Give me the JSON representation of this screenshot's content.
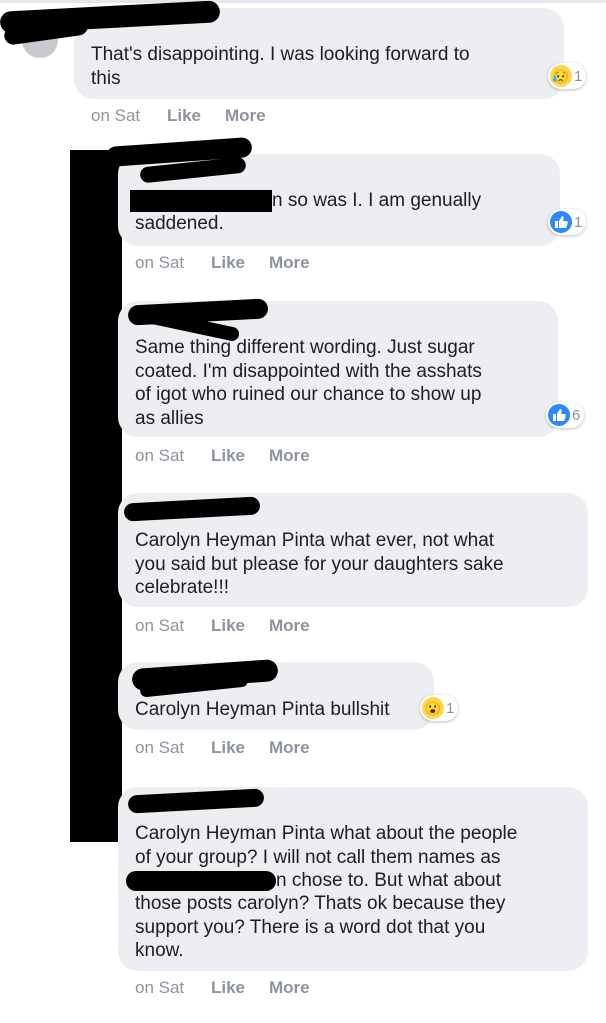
{
  "comments": [
    {
      "text": "That's disappointing. I was looking forward to\nthis",
      "timestamp": "on Sat",
      "like_label": "Like",
      "more_label": "More",
      "reaction": {
        "icon": "sad-emoji-icon",
        "glyph": "😥",
        "count": "1"
      }
    },
    {
      "text_line1": "n so was I. I am genually",
      "text_line2": "saddened.",
      "timestamp": "on Sat",
      "like_label": "Like",
      "more_label": "More",
      "reaction": {
        "icon": "thumbs-up-icon",
        "count": "1"
      }
    },
    {
      "text": "Same thing different wording. Just sugar\ncoated. I'm disappointed with the asshats\nof igot who ruined our chance to show up\nas allies",
      "timestamp": "on Sat",
      "like_label": "Like",
      "more_label": "More",
      "reaction": {
        "icon": "thumbs-up-icon",
        "count": "6"
      }
    },
    {
      "text": "Carolyn Heyman Pinta what ever, not what\nyou said but please for your daughters sake\ncelebrate!!!",
      "timestamp": "on Sat",
      "like_label": "Like",
      "more_label": "More"
    },
    {
      "text": "Carolyn Heyman Pinta bullshit",
      "timestamp": "on Sat",
      "like_label": "Like",
      "more_label": "More",
      "reaction": {
        "icon": "wow-emoji-icon",
        "glyph": "😮",
        "count": "1"
      }
    },
    {
      "text_lines_before": "Carolyn Heyman Pinta what about the people\nof your group? I will not call them names as",
      "text_partial": "n chose to. But what about",
      "text_lines_after": "those posts carolyn? Thats ok because they\nsupport you? There is a word dot that you\nknow.",
      "timestamp": "on Sat",
      "like_label": "Like",
      "more_label": "More"
    }
  ],
  "colors": {
    "like_blue": "#2d88ff",
    "bubble_gray": "#eceef2",
    "meta_gray": "#8d949e"
  }
}
